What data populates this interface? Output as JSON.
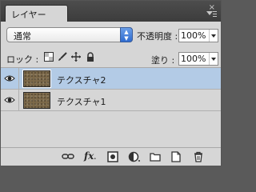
{
  "panel": {
    "tab_label": "レイヤー",
    "close_glyph": "×",
    "menu_icon": "panel-menu-icon"
  },
  "blend": {
    "mode": "通常"
  },
  "opacity": {
    "label": "不透明度 :",
    "value": "100%"
  },
  "lock": {
    "label": "ロック :",
    "icons": [
      "lock-transparent-icon",
      "lock-paint-icon",
      "lock-position-icon",
      "lock-all-icon"
    ]
  },
  "fill": {
    "label": "塗り :",
    "value": "100%"
  },
  "layers": [
    {
      "name": "テクスチャ2",
      "selected": true,
      "visible": true
    },
    {
      "name": "テクスチャ1",
      "selected": false,
      "visible": true
    }
  ],
  "bottom_icons": [
    "link-icon",
    "fx-icon",
    "mask-icon",
    "adjustment-icon",
    "folder-icon",
    "new-layer-icon",
    "trash-icon"
  ],
  "colors": {
    "selection": "#b3cbe6",
    "panel_bg": "#d6d6d6",
    "header_bg": "#444444",
    "stepper_blue": "#3a78d8"
  }
}
